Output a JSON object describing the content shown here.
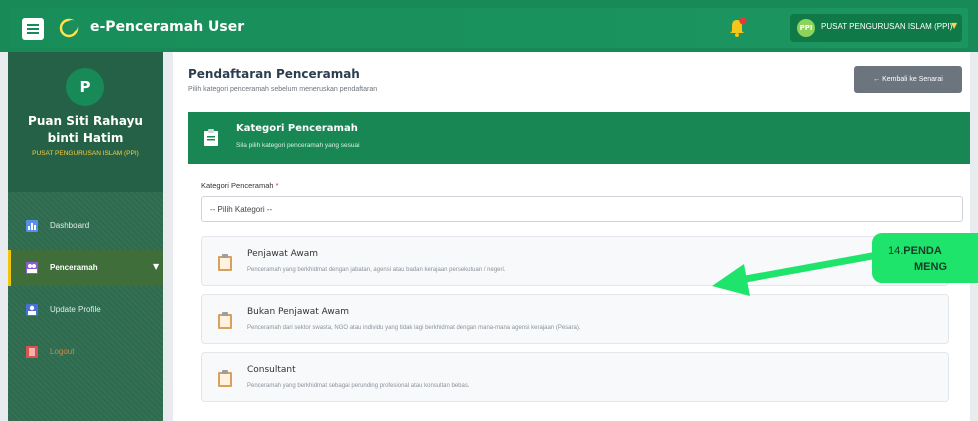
{
  "header": {
    "app_title": "e-Penceramah User",
    "user_initials": "PPI",
    "user_org": "PUSAT PENGURUSAN ISLAM (PPI)",
    "accent": "#178a57"
  },
  "sidebar": {
    "avatar_letter": "P",
    "user_name": "Puan Siti Rahayu binti Hatim",
    "user_org": "PUSAT PENGURUSAN ISLAM (PPI)",
    "items": [
      {
        "label": "Dashboard",
        "icon": "chart-icon"
      },
      {
        "label": "Penceramah",
        "icon": "users-icon",
        "active": true
      },
      {
        "label": "Update Profile",
        "icon": "user-edit-icon"
      },
      {
        "label": "Logout",
        "icon": "logout-icon"
      }
    ]
  },
  "main": {
    "page_title": "Pendaftaran Penceramah",
    "page_subtitle": "Pilih kategori penceramah sebelum meneruskan pendaftaran",
    "back_button": "← Kembali ke Senarai",
    "card": {
      "title": "Kategori Penceramah",
      "subtitle": "Sila pilih kategori penceramah yang sesuai"
    },
    "field_label": "Kategori Penceramah",
    "required_mark": "*",
    "select_value": "-- Pilih Kategori --",
    "options": [
      {
        "title": "Penjawat Awam",
        "desc": "Penceramah yang berkhidmat dengan jabatan, agensi atau badan kerajaan persekutuan / negeri."
      },
      {
        "title": "Bukan Penjawat Awam",
        "desc": "Penceramah dari sektor swasta, NGO atau individu yang tidak lagi berkhidmat dengan mana-mana agensi kerajaan (Pesara)."
      },
      {
        "title": "Consultant",
        "desc": "Penceramah yang berkhidmat sebagai perunding profesional atau konsultan bebas."
      }
    ]
  },
  "annotation": {
    "number": "14.",
    "line1": "PENDA",
    "line2": "MENG",
    "color": "#1fe46b"
  }
}
